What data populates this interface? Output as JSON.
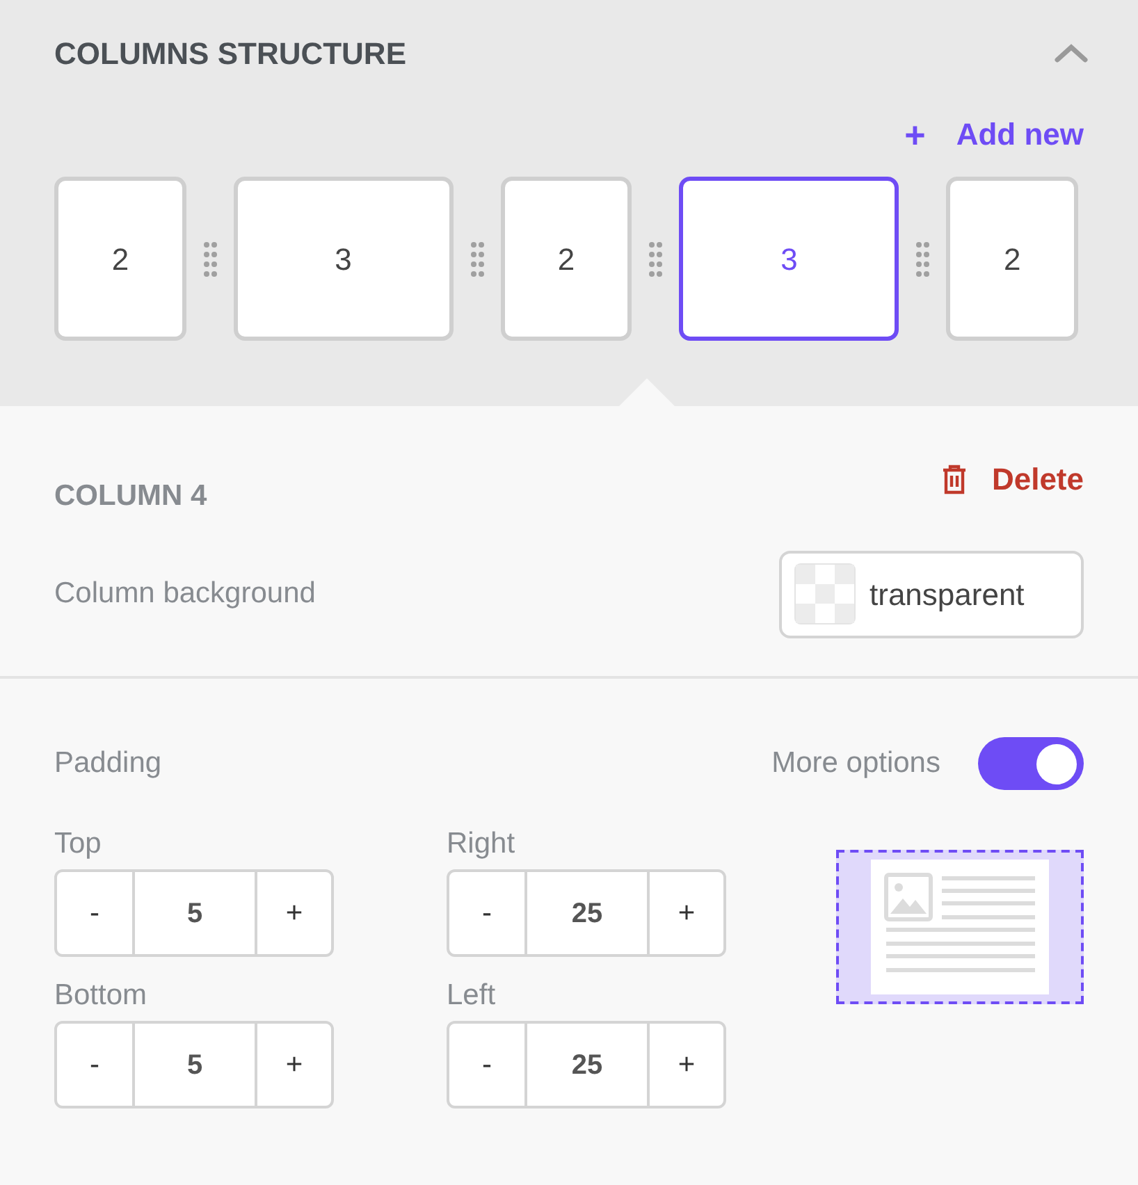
{
  "section": {
    "title": "COLUMNS STRUCTURE",
    "expanded": true,
    "add_button": {
      "icon": "+",
      "label": "Add new"
    }
  },
  "columns": [
    {
      "label": "2",
      "selected": false
    },
    {
      "label": "3",
      "selected": false
    },
    {
      "label": "2",
      "selected": false
    },
    {
      "label": "3",
      "selected": true
    },
    {
      "label": "2",
      "selected": false
    }
  ],
  "column_settings": {
    "title": "COLUMN 4",
    "delete_label": "Delete",
    "background_label": "Column background",
    "background_value": "transparent"
  },
  "padding": {
    "label": "Padding",
    "more_options_label": "More options",
    "more_options_on": true,
    "fields": [
      {
        "label": "Top",
        "value": "5"
      },
      {
        "label": "Right",
        "value": "25"
      },
      {
        "label": "Bottom",
        "value": "5"
      },
      {
        "label": "Left",
        "value": "25"
      }
    ],
    "minus": "-",
    "plus": "+"
  }
}
